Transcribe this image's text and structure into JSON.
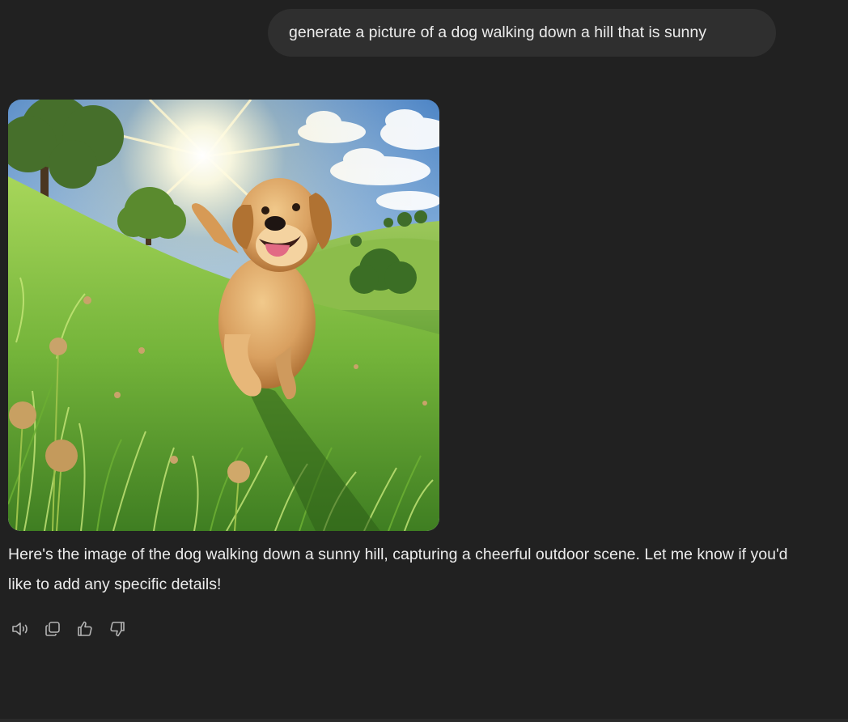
{
  "user_message": {
    "text": "generate a picture of a dog walking down a hill that is sunny"
  },
  "generated_image": {
    "subject": "golden retriever walking down a sunny grassy hill"
  },
  "assistant_message": {
    "text": "Here's the image of the dog walking down a sunny hill, capturing a cheerful outdoor scene. Let me know if you'd like to add any specific details!"
  },
  "actions": [
    {
      "name": "read-aloud",
      "icon": "speaker-icon"
    },
    {
      "name": "copy",
      "icon": "copy-icon"
    },
    {
      "name": "good-response",
      "icon": "thumbs-up-icon"
    },
    {
      "name": "bad-response",
      "icon": "thumbs-down-icon"
    }
  ],
  "colors": {
    "background": "#212121",
    "bubble": "#2f2f2f",
    "text": "#ececec",
    "icon": "#b4b4b4"
  }
}
